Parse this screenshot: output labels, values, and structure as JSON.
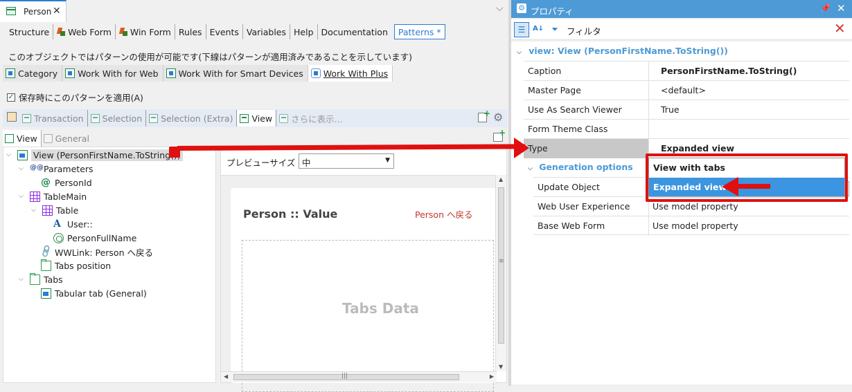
{
  "document_tab": {
    "label": "Person",
    "close": "✕"
  },
  "chevron": "⌵",
  "editor_tabs": [
    {
      "label": "Structure"
    },
    {
      "label": "Web Form"
    },
    {
      "label": "Win Form"
    },
    {
      "label": "Rules"
    },
    {
      "label": "Events"
    },
    {
      "label": "Variables"
    },
    {
      "label": "Help"
    },
    {
      "label": "Documentation"
    },
    {
      "label": "Patterns *"
    }
  ],
  "pattern_note": "このオブジェクトではパターンの使用が可能です(下線はパターンが適用済みであることを示しています)",
  "pattern_tabs": [
    {
      "label": "Category"
    },
    {
      "label": "Work With for Web"
    },
    {
      "label": "Work With for Smart Devices"
    },
    {
      "label": "Work With Plus"
    }
  ],
  "apply_on_save": {
    "label": "保存時にこのパターンを適用(A)",
    "checked": "✓"
  },
  "instance_tabs": [
    {
      "label": "Transaction"
    },
    {
      "label": "Selection"
    },
    {
      "label": "Selection (Extra)"
    },
    {
      "label": "View"
    },
    {
      "label": "さらに表示..."
    }
  ],
  "sub_tabs": [
    {
      "label": "View"
    },
    {
      "label": "General"
    }
  ],
  "tree": {
    "view": "View (PersonFirstName.ToString())",
    "parameters": "Parameters",
    "person_id": "PersonId",
    "table_main": "TableMain",
    "table": "Table",
    "user": "User::",
    "person_full_name": "PersonFullName",
    "wwlink": "WWLink:  Person へ戻る",
    "tabs_position": "Tabs position",
    "tabs": "Tabs",
    "tabular_tab": "Tabular tab (General)",
    "params_glyph": "@@",
    "at_glyph": "@",
    "attr_glyph": "A",
    "link_glyph": "🔗",
    "expanded": "⌵"
  },
  "preview": {
    "size_label": "プレビューサイズ",
    "size_value": "中",
    "title": "Person :: Value",
    "back_link": "Person へ戻る",
    "tabs_data": "Tabs Data"
  },
  "properties": {
    "title": "プロパティ",
    "filter_label": "フィルタ",
    "object_header": "view: View (PersonFirstName.ToString())",
    "rows": [
      {
        "name": "Caption",
        "value": "PersonFirstName.ToString()"
      },
      {
        "name": "Master Page",
        "value": "<default>"
      },
      {
        "name": "Use As Search Viewer",
        "value": "True"
      },
      {
        "name": "Form Theme Class",
        "value": ""
      },
      {
        "name": "Type",
        "value": "Expanded view"
      }
    ],
    "generation_header": "Generation options",
    "gen_rows": [
      {
        "name": "Update Object",
        "value": ""
      },
      {
        "name": "Web User Experience",
        "value": "Use model property"
      },
      {
        "name": "Base Web Form",
        "value": "Use model property"
      }
    ],
    "type_options": [
      "View with tabs",
      "Expanded view"
    ]
  },
  "colors": {
    "accent": "#4d9ad6",
    "annotation": "#e01010",
    "selection": "#3b95e0"
  }
}
